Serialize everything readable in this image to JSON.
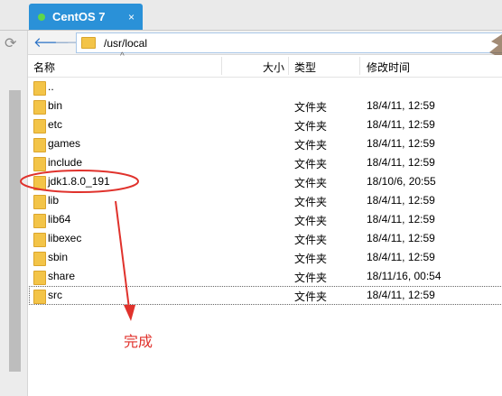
{
  "tab": {
    "title": "CentOS 7",
    "close": "×"
  },
  "address": {
    "path": "/usr/local"
  },
  "columns": {
    "name": "名称",
    "size": "大小",
    "type": "类型",
    "modified": "修改时间"
  },
  "files": [
    {
      "name": "..",
      "type": "",
      "modified": ""
    },
    {
      "name": "bin",
      "type": "文件夹",
      "modified": "18/4/11, 12:59"
    },
    {
      "name": "etc",
      "type": "文件夹",
      "modified": "18/4/11, 12:59"
    },
    {
      "name": "games",
      "type": "文件夹",
      "modified": "18/4/11, 12:59"
    },
    {
      "name": "include",
      "type": "文件夹",
      "modified": "18/4/11, 12:59"
    },
    {
      "name": "jdk1.8.0_191",
      "type": "文件夹",
      "modified": "18/10/6, 20:55"
    },
    {
      "name": "lib",
      "type": "文件夹",
      "modified": "18/4/11, 12:59"
    },
    {
      "name": "lib64",
      "type": "文件夹",
      "modified": "18/4/11, 12:59"
    },
    {
      "name": "libexec",
      "type": "文件夹",
      "modified": "18/4/11, 12:59"
    },
    {
      "name": "sbin",
      "type": "文件夹",
      "modified": "18/4/11, 12:59"
    },
    {
      "name": "share",
      "type": "文件夹",
      "modified": "18/11/16, 00:54"
    },
    {
      "name": "src",
      "type": "文件夹",
      "modified": "18/4/11, 12:59"
    }
  ],
  "annotation": {
    "label": "完成"
  },
  "colors": {
    "tab": "#2a91d8",
    "folder": "#f3c448",
    "annotation": "#e0322c"
  }
}
